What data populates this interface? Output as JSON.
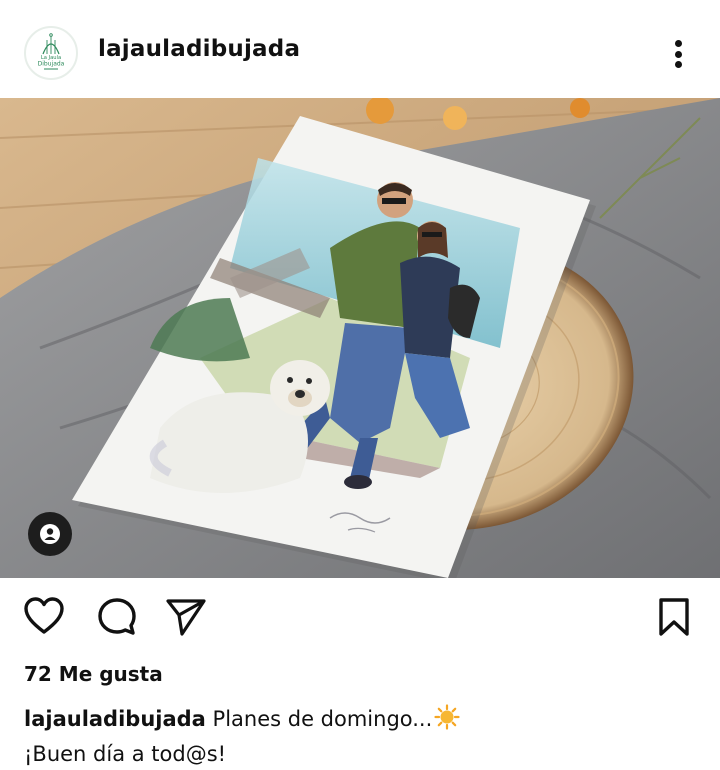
{
  "post": {
    "username": "lajauladibujada",
    "avatar_text_line1": "La Jaula",
    "avatar_text_line2": "Dibujada",
    "more_icon": "more-vertical-icon",
    "tag_icon": "user-tag-icon",
    "icons": {
      "like": "heart-icon",
      "comment": "comment-icon",
      "share": "send-icon",
      "save": "bookmark-icon"
    },
    "likes_text": "72 Me gusta",
    "caption_user": "lajauladibujada",
    "caption_text": "Planes de domingo...",
    "caption_emoji": "sun-emoji",
    "caption_line2": "¡Buen día a tod@s!"
  },
  "colors": {
    "text": "#111111",
    "avatar_green": "#2e8a5c",
    "wood_table": "#caa678",
    "linen": "#8c8d8f",
    "paper": "#f4f4f2",
    "sun": "#f5a623"
  }
}
